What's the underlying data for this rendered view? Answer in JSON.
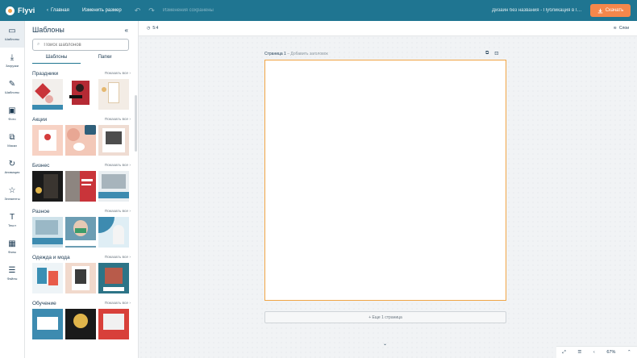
{
  "app": {
    "name": "Flyvi"
  },
  "topbar": {
    "home_label": "Главная",
    "resize_label": "Изменить размер",
    "changes_label": "Изменения сохранены",
    "doc_title": "Дизайн без названия - Публикация в In...",
    "download_label": "Скачать"
  },
  "rail": [
    {
      "icon": "templates-icon",
      "label": "Шаблоны"
    },
    {
      "icon": "upload-icon",
      "label": "Загрузки"
    },
    {
      "icon": "edit-icon",
      "label": "Шаблоны"
    },
    {
      "icon": "photo-icon",
      "label": "Фото"
    },
    {
      "icon": "mask-icon",
      "label": "Маски"
    },
    {
      "icon": "animation-icon",
      "label": "Анимация"
    },
    {
      "icon": "elements-icon",
      "label": "Элементы"
    },
    {
      "icon": "text-icon",
      "label": "Текст"
    },
    {
      "icon": "background-icon",
      "label": "Фоны"
    },
    {
      "icon": "files-icon",
      "label": "Файлы"
    }
  ],
  "panel": {
    "title": "Шаблоны",
    "search_placeholder": "Поиск шаблонов",
    "tabs": [
      "Шаблоны",
      "Папки"
    ],
    "show_all": "Показать все",
    "categories": [
      {
        "title": "Праздники"
      },
      {
        "title": "Акции"
      },
      {
        "title": "Бизнес"
      },
      {
        "title": "Разное"
      },
      {
        "title": "Одежда и мода"
      },
      {
        "title": "Обучение"
      }
    ]
  },
  "workspace": {
    "size_label": "5:4",
    "layers_label": "Слои",
    "page_title": "Страница 1",
    "add_title": "Добавить заголовок",
    "add_page_label": "+ Еще 1 страница",
    "zoom": "67%"
  },
  "colors": {
    "topbar": "#1f7591",
    "accent": "#f4874b",
    "page_border": "#f0a545"
  }
}
